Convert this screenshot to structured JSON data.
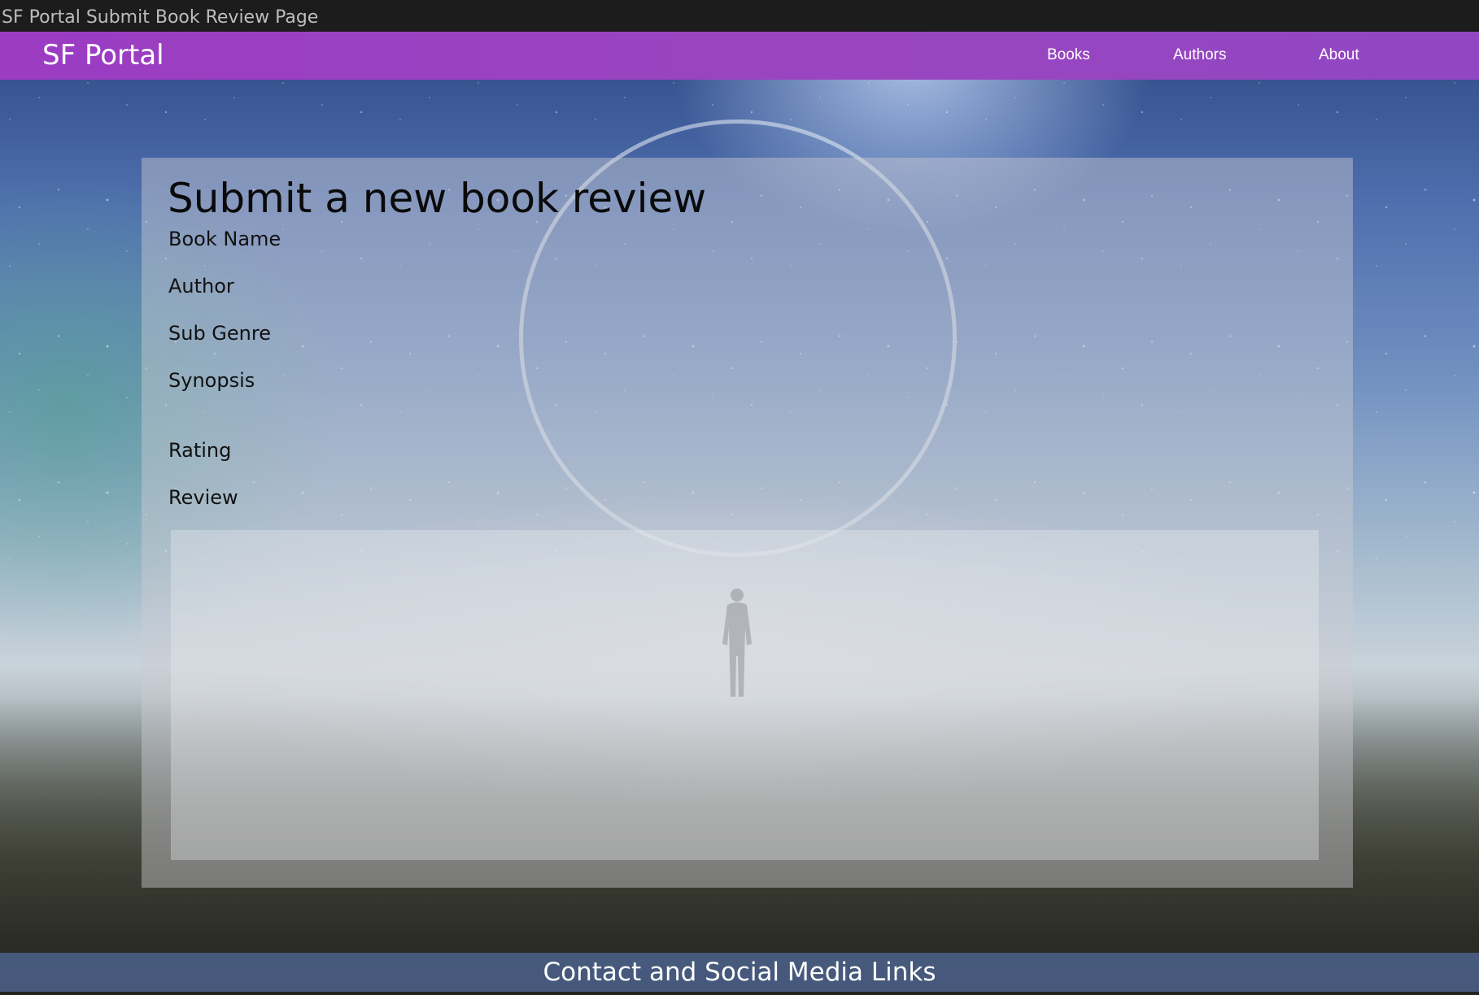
{
  "window": {
    "title": "SF Portal Submit Book Review Page"
  },
  "navbar": {
    "brand": "SF Portal",
    "links": [
      {
        "label": "Books"
      },
      {
        "label": "Authors"
      },
      {
        "label": "About"
      }
    ],
    "color": "#9b3cc3"
  },
  "form": {
    "title": "Submit a new book review",
    "fields": [
      {
        "label": "Book Name"
      },
      {
        "label": "Author"
      },
      {
        "label": "Sub Genre"
      },
      {
        "label": "Synopsis"
      },
      {
        "label": "Rating"
      },
      {
        "label": "Review"
      }
    ],
    "review_value": ""
  },
  "footer": {
    "text": "Contact and Social Media Links",
    "color": "#5068a0"
  },
  "icons": [
    "decorative-ring",
    "standing-figure"
  ]
}
